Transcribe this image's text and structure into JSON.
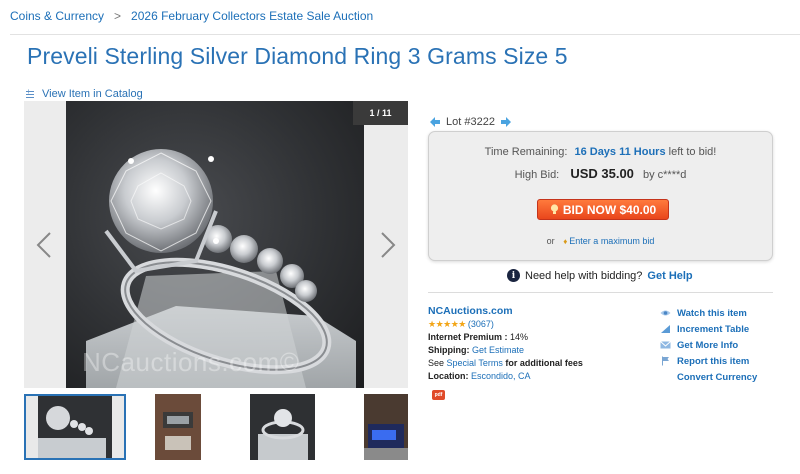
{
  "breadcrumb": {
    "items": [
      "Coins & Currency",
      "2026 February Collectors Estate Sale Auction"
    ],
    "separator": ">"
  },
  "title": "Preveli Sterling Silver Diamond Ring 3 Grams Size 5",
  "catalog_link": "View Item in Catalog",
  "gallery": {
    "counter": "1 / 11",
    "watermark": "NCauctions.com©"
  },
  "lot": {
    "label": "Lot #3222"
  },
  "bid": {
    "time_label": "Time Remaining:",
    "time_value": "16 Days 11 Hours",
    "time_suffix": "left to bid!",
    "high_label": "High Bid:",
    "high_value": "USD 35.00",
    "high_by": "by c****d",
    "button_label": "BID NOW $40.00",
    "or_text": "or",
    "max_link": "Enter a maximum bid"
  },
  "help": {
    "text": "Need help with bidding?",
    "link": "Get Help"
  },
  "seller": {
    "name": "NCAuctions.com",
    "stars": "★★★★★",
    "rating_count": "(3067)",
    "premium_label": "Internet Premium :",
    "premium_value": "14%",
    "shipping_label": "Shipping:",
    "shipping_value": "Get Estimate",
    "see_prefix": "See",
    "see_link": "Special Terms",
    "see_suffix": "for additional fees",
    "location_label": "Location:",
    "location_value": "Escondido, CA",
    "pdf_badge": "pdf"
  },
  "actions": {
    "watch": "Watch this item",
    "increment": "Increment Table",
    "info": "Get More Info",
    "report": "Report this item",
    "currency": "Convert Currency"
  },
  "colors": {
    "link": "#1c6fb8",
    "bid_button": "#e9461c",
    "stars": "#f2a516"
  }
}
